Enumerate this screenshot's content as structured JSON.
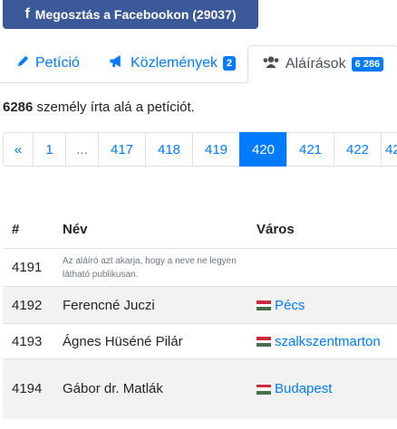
{
  "share": {
    "label": "Megosztás a Facebookon (29037)"
  },
  "tabs": [
    {
      "label": "Petíció"
    },
    {
      "label": "Közlemények",
      "badge": "2"
    },
    {
      "label": "Aláírások",
      "badge": "6 286"
    }
  ],
  "summary": {
    "count": "6286",
    "text": " személy írta alá a petíciót."
  },
  "pagination": [
    "«",
    "1",
    "...",
    "417",
    "418",
    "419",
    "420",
    "421",
    "422",
    "42"
  ],
  "table": {
    "headers": [
      "#",
      "Név",
      "Város"
    ],
    "rows": [
      {
        "num": "4191",
        "name": "Az aláíró azt akarja, hogy a neve ne legyen látható publikusan.",
        "city": ""
      },
      {
        "num": "4192",
        "name": "Ferencné Juczi",
        "city": "Pécs"
      },
      {
        "num": "4193",
        "name": "Ágnes Hüséné Pilár",
        "city": "szalkszentmarton"
      },
      {
        "num": "4194",
        "name": "Gábor dr. Matlák",
        "city": "Budapest"
      }
    ]
  },
  "colors": {
    "accent": "#007bff",
    "facebook": "#3b5998",
    "flag_red": "#cd2a3e",
    "flag_white": "#ffffff",
    "flag_green": "#436f4d"
  }
}
